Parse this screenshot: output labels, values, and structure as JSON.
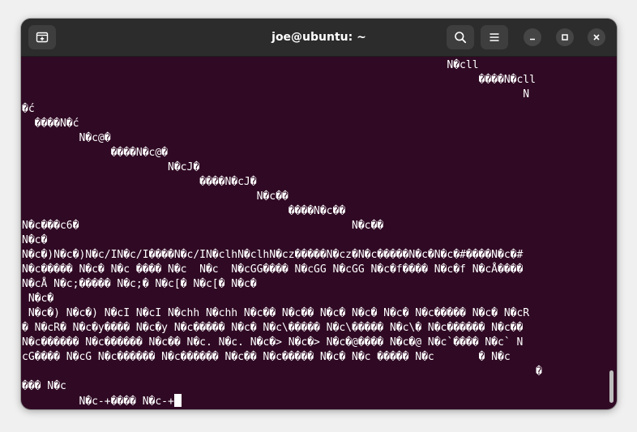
{
  "window": {
    "title": "joe@ubuntu: ~"
  },
  "titlebar": {
    "icons": {
      "new_tab": "new-tab-icon",
      "search": "search-icon",
      "menu": "hamburger-menu-icon",
      "minimize": "minimize-icon",
      "maximize": "maximize-icon",
      "close": "close-icon"
    }
  },
  "terminal": {
    "background": "#300a24",
    "foreground": "#ffffff",
    "lines": [
      "                                                                   N�cll",
      "                                                                        ����N�cll",
      "                                                                               N",
      "�ć",
      "  ����N�ć",
      "         N�c@�",
      "              ����N�c@�",
      "                       N�cJ�",
      "                            ����N�cJ�",
      "                                     N�c��",
      "                                          ����N�c��",
      "N�c���c6�                                           N�c��",
      "N�c�",
      "N�c�)N�c�)N�c/IN�c/I����N�c/IN�clhN�clhN�cz�����N�cz�N�c�����N�c�N�c�#����N�c�#",
      "N�c����� N�c� N�c ���� N�c  N�c  N�cGG���� N�cGG N�cGG N�c�f���� N�c�f N�cÅ����",
      "N�cÅ N�c;����� N�c;� N�c[� N�c[� N�c�",
      " N�c�",
      " N�c�) N�c�) N�cI N�cI N�chh N�chh N�c�� N�c�� N�c� N�c� N�c� N�c����� N�c� N�cR",
      "� N�cR� N�c�y���� N�c�y N�c����� N�c� N�c\\����� N�c\\����� N�c\\� N�c������ N�c��",
      "N�c������ N�c������ N�c�� N�c. N�c. N�c�> N�c�> N�c�@���� N�c�@ N�c`���� N�c` N",
      "cG���� N�cG N�c������ N�c������ N�c�� N�c����� N�c� N�c ����� N�c       � N�c",
      "                                                                                 �",
      "��� N�c",
      "         N�c-+���� N�c-+"
    ]
  }
}
